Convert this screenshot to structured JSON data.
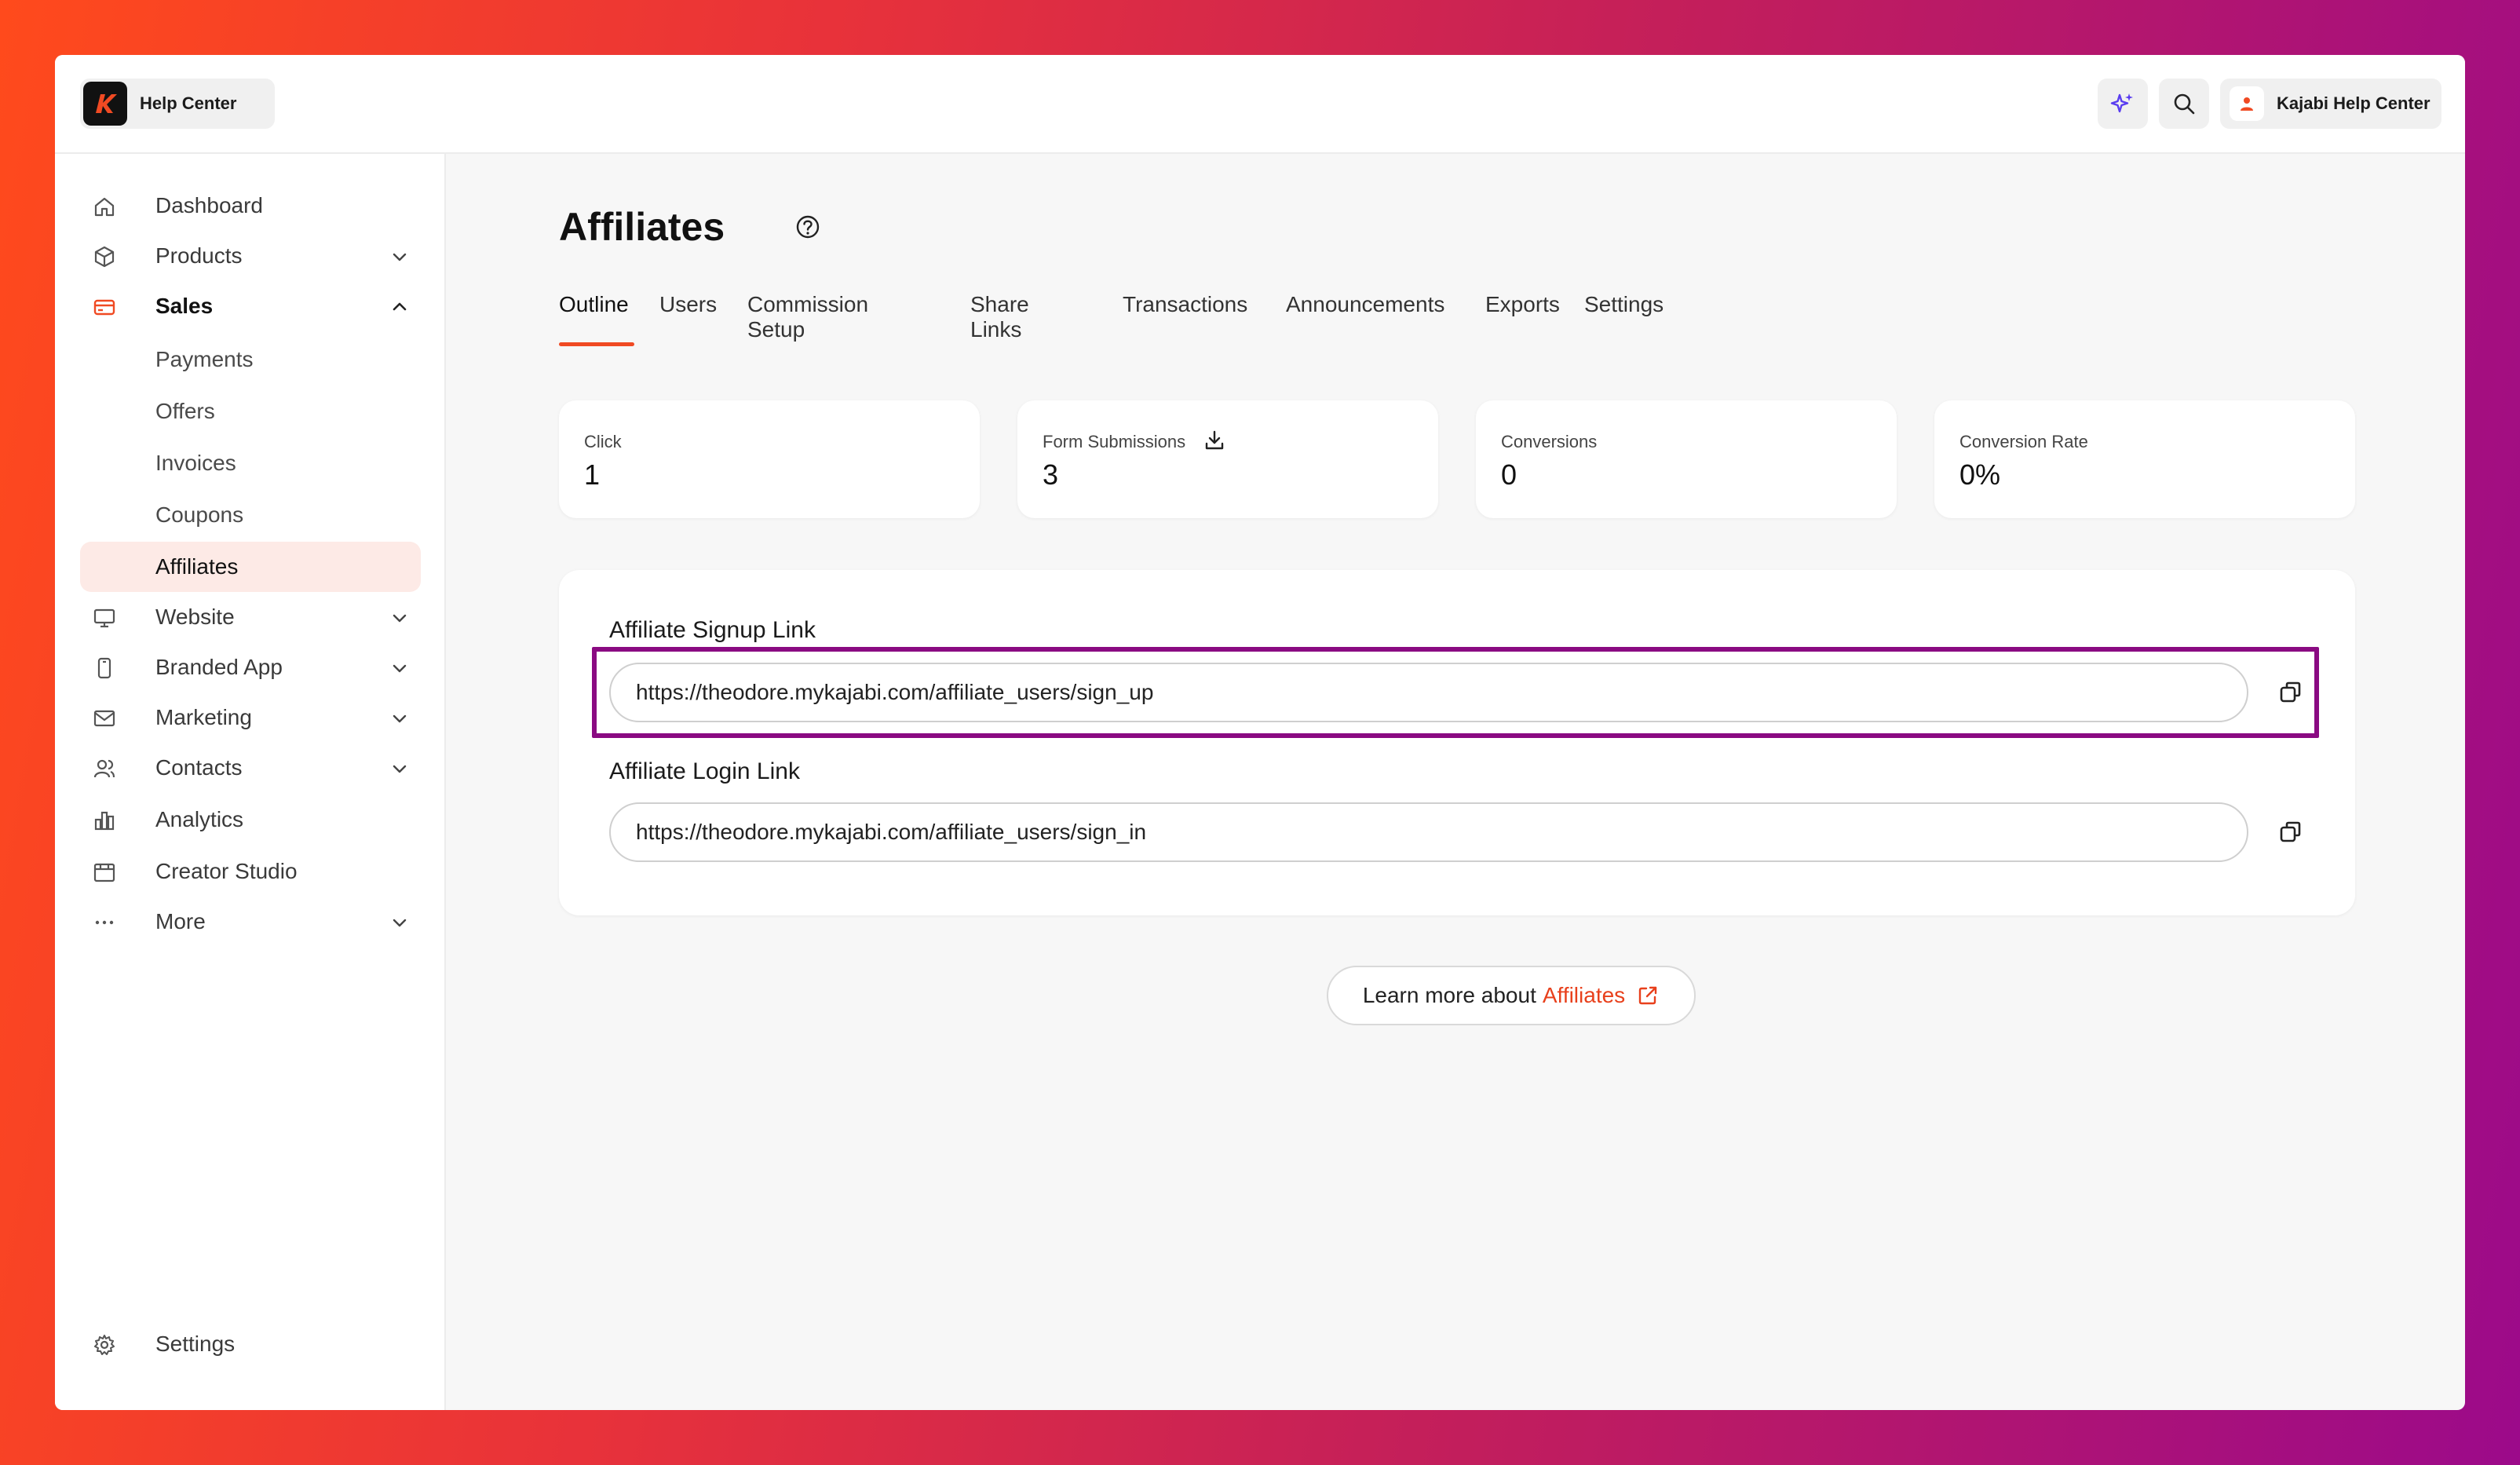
{
  "header": {
    "brand_label": "Help Center",
    "account_name": "Kajabi Help Center",
    "ai_icon": "sparkle-icon",
    "search_icon": "search-icon"
  },
  "sidebar": {
    "items": [
      {
        "label": "Dashboard",
        "icon": "home-icon"
      },
      {
        "label": "Products",
        "icon": "box-icon"
      },
      {
        "label": "Sales",
        "icon": "credit-card-icon"
      },
      {
        "label": "Website",
        "icon": "monitor-icon"
      },
      {
        "label": "Branded App",
        "icon": "phone-icon"
      },
      {
        "label": "Marketing",
        "icon": "mail-icon"
      },
      {
        "label": "Contacts",
        "icon": "users-icon"
      },
      {
        "label": "Analytics",
        "icon": "bar-chart-icon"
      },
      {
        "label": "Creator Studio",
        "icon": "calendar-icon"
      },
      {
        "label": "More",
        "icon": "more-icon"
      }
    ],
    "sales_sub": [
      "Payments",
      "Offers",
      "Invoices",
      "Coupons",
      "Affiliates"
    ],
    "settings_label": "Settings"
  },
  "page": {
    "title": "Affiliates",
    "tabs": [
      "Outline",
      "Users",
      "Commission Setup",
      "Share Links",
      "Transactions",
      "Announcements",
      "Exports",
      "Settings"
    ]
  },
  "stats": [
    {
      "label": "Click",
      "value": "1"
    },
    {
      "label": "Form Submissions",
      "value": "3"
    },
    {
      "label": "Conversions",
      "value": "0"
    },
    {
      "label": "Conversion Rate",
      "value": "0%"
    }
  ],
  "links": {
    "signup_label": "Affiliate Signup Link",
    "signup_url": "https://theodore.mykajabi.com/affiliate_users/sign_up",
    "login_label": "Affiliate Login Link",
    "login_url": "https://theodore.mykajabi.com/affiliate_users/sign_in"
  },
  "learn_more": {
    "prefix": "Learn more about",
    "link": "Affiliates"
  },
  "colors": {
    "accent": "#f04a23",
    "highlight": "#8a0a82",
    "selected_bg": "#fdeae6"
  }
}
